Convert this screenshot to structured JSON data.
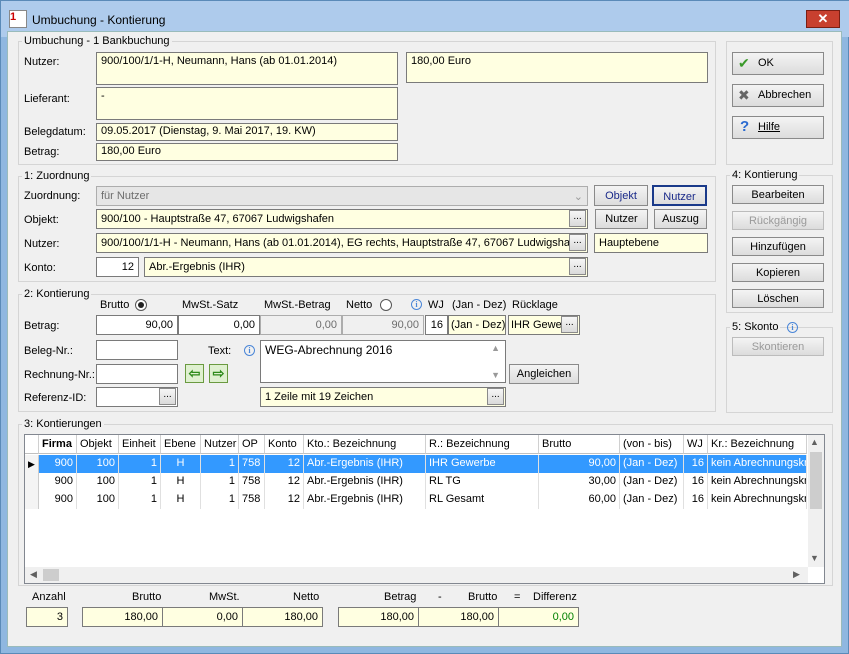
{
  "window": {
    "title": "Umbuchung - Kontierung",
    "close": "✕",
    "app_icon": "1"
  },
  "header": {
    "group": "Umbuchung - 1 Bankbuchung",
    "nutzer_label": "Nutzer:",
    "nutzer_value": "900/100/1/1-H,  Neumann, Hans  (ab 01.01.2014)",
    "amount": "180,00  Euro",
    "lieferant_label": "Lieferant:",
    "lieferant_value": "-",
    "belegdatum_label": "Belegdatum:",
    "belegdatum_value": "09.05.2017  (Dienstag,  9. Mai 2017,  19. KW)",
    "betrag_label": "Betrag:",
    "betrag_value": "180,00  Euro"
  },
  "side": {
    "ok": "OK",
    "abbrechen": "Abbrechen",
    "hilfe": "Hilfe",
    "kontierung_group": "4: Kontierung",
    "bearbeiten": "Bearbeiten",
    "rueckgaengig": "Rückgängig",
    "hinzufuegen": "Hinzufügen",
    "kopieren": "Kopieren",
    "loeschen": "Löschen",
    "skonto_group": "5: Skonto",
    "skontieren": "Skontieren"
  },
  "zuordnung": {
    "group": "1: Zuordnung",
    "zuordnung_label": "Zuordnung:",
    "zuordnung_value": "für Nutzer",
    "objekt_btn": "Objekt",
    "nutzer_btn": "Nutzer",
    "objekt_label": "Objekt:",
    "objekt_value": "900/100 - Hauptstraße 47, 67067 Ludwigshafen",
    "nutzer_btn2": "Nutzer",
    "auszug_btn": "Auszug",
    "nutzer_label": "Nutzer:",
    "nutzer_value": "900/100/1/1-H - Neumann, Hans  (ab 01.01.2014), EG rechts, Hauptstraße 47, 67067 Ludwigshaf",
    "ebene": "Hauptebene",
    "konto_label": "Konto:",
    "konto_nr": "12",
    "konto_name": "Abr.-Ergebnis (IHR)"
  },
  "kontierung": {
    "group": "2: Kontierung",
    "brutto": "Brutto",
    "mwst_satz": "MwSt.-Satz",
    "mwst_betrag": "MwSt.-Betrag",
    "netto": "Netto",
    "wj": "WJ",
    "jan_dez": "(Jan - Dez)",
    "ruecklage": "Rücklage",
    "betrag_label": "Betrag:",
    "brutto_val": "90,00",
    "mwst_satz_val": "0,00",
    "mwst_betrag_val": "0,00",
    "netto_val": "90,00",
    "wj_val": "16",
    "period_val": "(Jan - Dez)",
    "ruecklage_val": "IHR Gewe",
    "beleg_label": "Beleg-Nr.:",
    "text_label": "Text:",
    "text_value": "WEG-Abrechnung 2016",
    "rechnung_label": "Rechnung-Nr.:",
    "angleichen": "Angleichen",
    "referenz_label": "Referenz-ID:",
    "zeilen": "1 Zeile mit 19 Zeichen"
  },
  "table": {
    "group": "3: Kontierungen",
    "columns": [
      "Firma",
      "Objekt",
      "Einheit",
      "Ebene",
      "Nutzer",
      "OP",
      "Konto",
      "Kto.: Bezeichnung",
      "R.: Bezeichnung",
      "Brutto",
      "(von - bis)",
      "WJ",
      "Kr.: Bezeichnung"
    ],
    "rows": [
      [
        "900",
        "100",
        "1",
        "H",
        "1",
        "758",
        "12",
        "Abr.-Ergebnis (IHR)",
        "IHR Gewerbe",
        "90,00",
        "(Jan - Dez)",
        "16",
        "kein Abrechnungskr"
      ],
      [
        "900",
        "100",
        "1",
        "H",
        "1",
        "758",
        "12",
        "Abr.-Ergebnis (IHR)",
        "RL TG",
        "30,00",
        "(Jan - Dez)",
        "16",
        "kein Abrechnungskr"
      ],
      [
        "900",
        "100",
        "1",
        "H",
        "1",
        "758",
        "12",
        "Abr.-Ergebnis (IHR)",
        "RL Gesamt",
        "60,00",
        "(Jan - Dez)",
        "16",
        "kein Abrechnungskr"
      ]
    ]
  },
  "totals": {
    "anzahl": "Anzahl",
    "brutto": "Brutto",
    "mwst": "MwSt.",
    "netto": "Netto",
    "betrag": "Betrag",
    "minus": "-",
    "brutto2": "Brutto",
    "eq": "=",
    "differenz": "Differenz",
    "anzahl_val": "3",
    "brutto_val": "180,00",
    "mwst_val": "0,00",
    "netto_val": "180,00",
    "betrag_val": "180,00",
    "brutto2_val": "180,00",
    "differenz_val": "0,00"
  },
  "colors": {
    "selection": "#3399ff",
    "field_yellow": "#ffffe1",
    "title_bar": "#aecbec",
    "differenz_text": "#008000"
  }
}
